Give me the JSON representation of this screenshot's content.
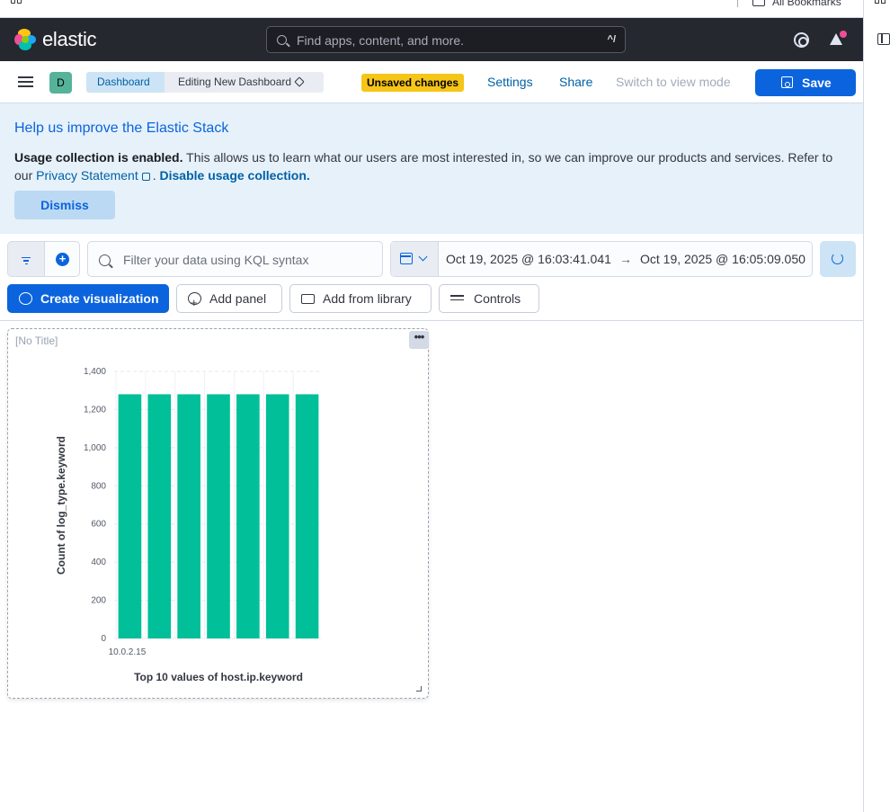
{
  "browser": {
    "bookmarks_label": "All Bookmarks"
  },
  "topnav": {
    "logo_text": "elastic",
    "search_placeholder": "Find apps, content, and more.",
    "search_shortcut": "^/"
  },
  "subnav": {
    "avatar_letter": "D",
    "breadcrumbs": [
      "Dashboard",
      "Editing New Dashboard"
    ],
    "unsaved_badge": "Unsaved changes",
    "settings": "Settings",
    "share": "Share",
    "switch_mode": "Switch to view mode",
    "save": "Save"
  },
  "callout": {
    "title": "Help us improve the Elastic Stack",
    "strong_text": "Usage collection is enabled.",
    "body_text": " This allows us to learn what our users are most interested in, so we can improve our products and services. Refer to our ",
    "privacy_link": "Privacy Statement",
    "period": ". ",
    "disable_link": "Disable usage collection.",
    "dismiss": "Dismiss"
  },
  "query": {
    "kql_placeholder": "Filter your data using KQL syntax",
    "date_start": "Oct 19, 2025 @ 16:03:41.041",
    "date_arrow": "→",
    "date_end": "Oct 19, 2025 @ 16:05:09.050"
  },
  "toolbar": {
    "create_viz": "Create visualization",
    "add_panel": "Add panel",
    "add_from_library": "Add from library",
    "controls": "Controls"
  },
  "panel": {
    "title": "[No Title]",
    "menu_glyph": "•••"
  },
  "colors": {
    "bar": "#00bf99",
    "brand_blue": "#0b64dd",
    "nav_dark": "#25282f"
  },
  "chart_data": {
    "type": "bar",
    "categories": [
      "10.0.2.15",
      "",
      "",
      "",
      "",
      "",
      ""
    ],
    "values": [
      1280,
      1280,
      1280,
      1280,
      1280,
      1280,
      1280
    ],
    "xlabel": "Top 10 values of host.ip.keyword",
    "ylabel": "Count of log_type.keyword",
    "ylim": [
      0,
      1400
    ],
    "yticks": [
      0,
      200,
      400,
      600,
      800,
      1000,
      1200,
      1400
    ],
    "ytick_labels": [
      "0",
      "200",
      "400",
      "600",
      "800",
      "1,000",
      "1,200",
      "1,400"
    ],
    "grid": true
  }
}
